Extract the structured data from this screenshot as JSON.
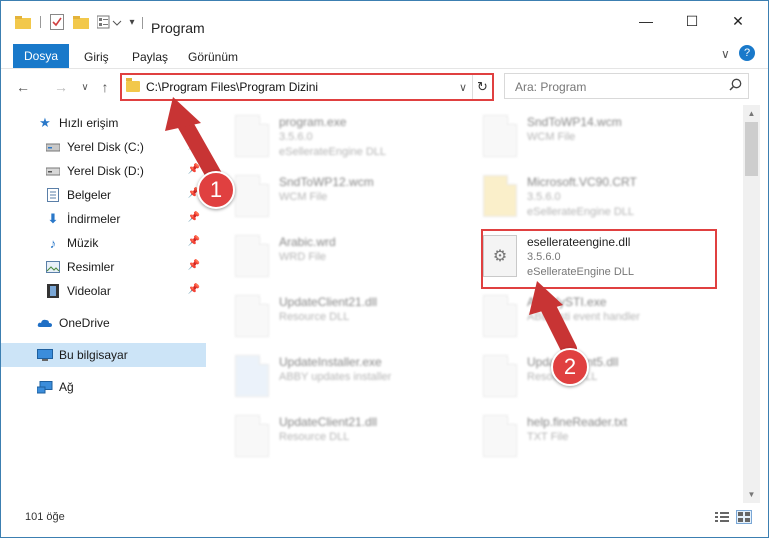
{
  "window": {
    "title": "Program",
    "minimize": "—",
    "maximize": "☐",
    "close": "✕"
  },
  "ribbon": {
    "tabs": [
      "Dosya",
      "Giriş",
      "Paylaş",
      "Görünüm"
    ],
    "expand": "∨",
    "help": "?"
  },
  "nav": {
    "back": "←",
    "forward": "→",
    "recent": "∨",
    "up": "↑",
    "address": "C:\\Program Files\\Program Dizini",
    "address_dropdown": "∨",
    "refresh": "↻",
    "search_placeholder": "Ara: Program",
    "search_icon": "search-icon"
  },
  "sidebar": {
    "items": [
      {
        "label": "Hızlı erişim",
        "icon": "star-icon",
        "pinned": false
      },
      {
        "label": "Yerel Disk (C:)",
        "icon": "drive-icon",
        "pinned": true
      },
      {
        "label": "Yerel Disk (D:)",
        "icon": "drive-icon",
        "pinned": true
      },
      {
        "label": "Belgeler",
        "icon": "documents-icon",
        "pinned": true
      },
      {
        "label": "İndirmeler",
        "icon": "download-icon",
        "pinned": true
      },
      {
        "label": "Müzik",
        "icon": "music-icon",
        "pinned": true
      },
      {
        "label": "Resimler",
        "icon": "pictures-icon",
        "pinned": true
      },
      {
        "label": "Videolar",
        "icon": "videos-icon",
        "pinned": true
      },
      {
        "label": "OneDrive",
        "icon": "cloud-icon",
        "pinned": false
      },
      {
        "label": "Bu bilgisayar",
        "icon": "computer-icon",
        "pinned": false,
        "selected": true
      },
      {
        "label": "Ağ",
        "icon": "network-icon",
        "pinned": false
      }
    ],
    "pin_glyph": "📌"
  },
  "files": {
    "left": [
      {
        "name": "program.exe",
        "line2": "3.5.6.0",
        "line3": "eSellerateEngine DLL"
      },
      {
        "name": "SndToWP12.wcm",
        "line2": "WCM File",
        "line3": ""
      },
      {
        "name": "Arabic.wrd",
        "line2": "WRD File",
        "line3": ""
      },
      {
        "name": "UpdateClient21.dll",
        "line2": "Resource DLL",
        "line3": ""
      },
      {
        "name": "UpdateInstaller.exe",
        "line2": "ABBY updates installer",
        "line3": ""
      },
      {
        "name": "UpdateClient21.dll",
        "line2": "Resource DLL",
        "line3": ""
      }
    ],
    "right": [
      {
        "name": "SndToWP14.wcm",
        "line2": "WCM File",
        "line3": ""
      },
      {
        "name": "Microsoft.VC90.CRT",
        "line2": "3.5.6.0",
        "line3": "eSellerateEngine DLL"
      },
      {
        "name": "esellerateengine.dll",
        "line2": "3.5.6.0",
        "line3": "eSellerateEngine DLL"
      },
      {
        "name": "ABBYySTI.exe",
        "line2": "ABBY sti event handler",
        "line3": ""
      },
      {
        "name": "UpdateClient5.dll",
        "line2": "Resource DLL",
        "line3": ""
      },
      {
        "name": "help.fineReader.txt",
        "line2": "TXT File",
        "line3": ""
      }
    ]
  },
  "status": {
    "count": "101 öğe"
  },
  "annotations": {
    "step1": "1",
    "step2": "2",
    "color": "#e04040"
  }
}
